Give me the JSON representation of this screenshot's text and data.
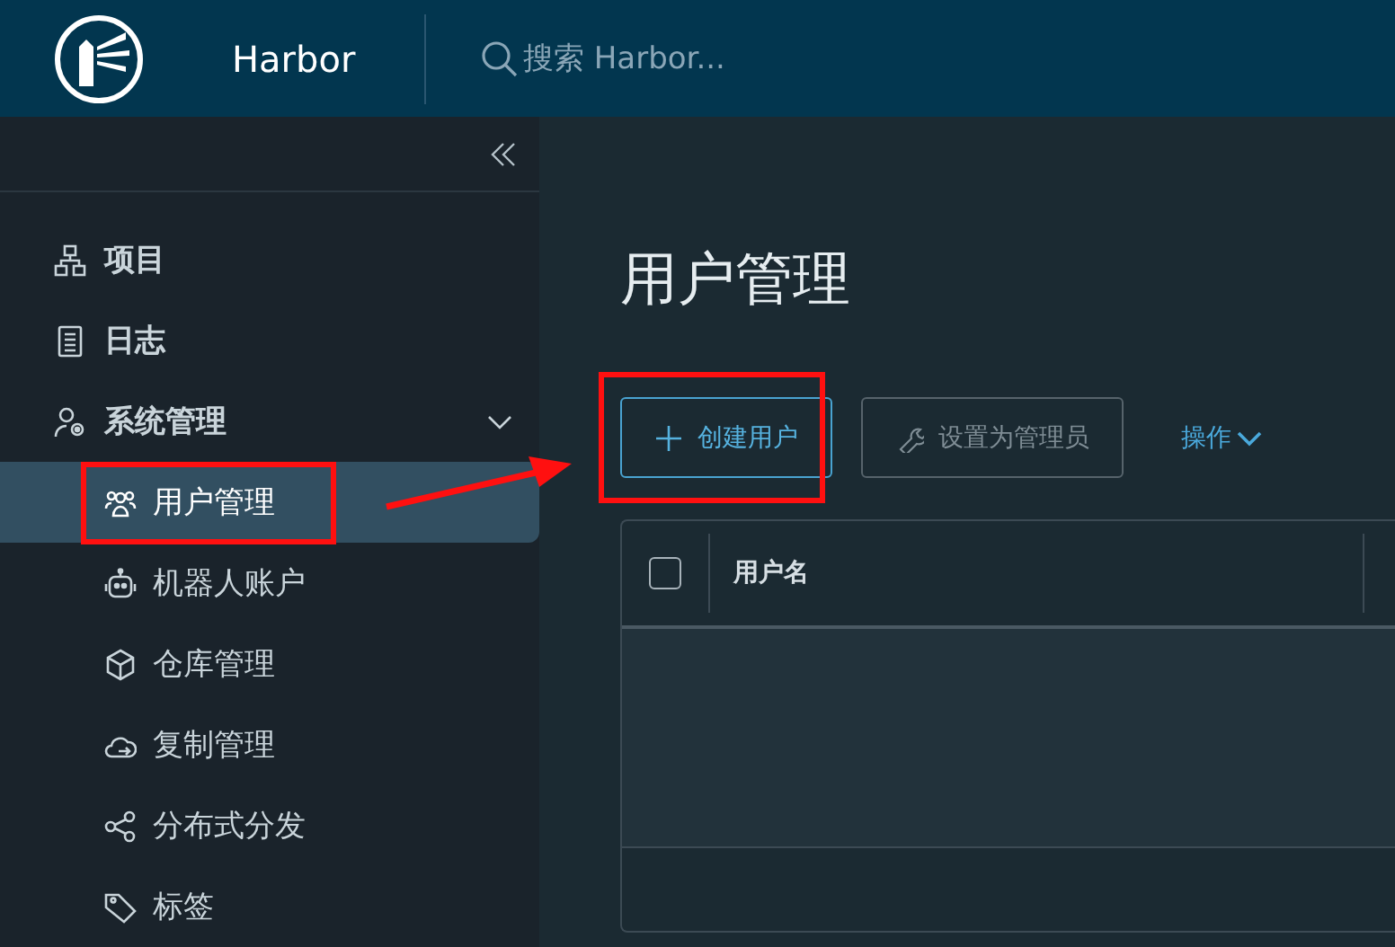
{
  "header": {
    "title": "Harbor",
    "search": {
      "placeholder": "搜索 Harbor..."
    }
  },
  "sidebar": {
    "items": [
      {
        "label": "项目",
        "selected": false
      },
      {
        "label": "日志",
        "selected": false
      },
      {
        "label": "系统管理",
        "selected": false,
        "expanded": true,
        "children": [
          {
            "label": "用户管理",
            "selected": true
          },
          {
            "label": "机器人账户",
            "selected": false
          },
          {
            "label": "仓库管理",
            "selected": false
          },
          {
            "label": "复制管理",
            "selected": false
          },
          {
            "label": "分布式分发",
            "selected": false
          },
          {
            "label": "标签",
            "selected": false
          }
        ]
      }
    ]
  },
  "main": {
    "title": "用户管理",
    "toolbar": [
      {
        "label": "创建用户",
        "kind": "primary",
        "disabled": false
      },
      {
        "label": "设置为管理员",
        "kind": "outline",
        "disabled": true
      },
      {
        "label": "操作",
        "kind": "dropdown",
        "disabled": false
      }
    ],
    "table": {
      "select_all": {
        "checked": false
      },
      "columns": [
        "用户名"
      ]
    }
  }
}
